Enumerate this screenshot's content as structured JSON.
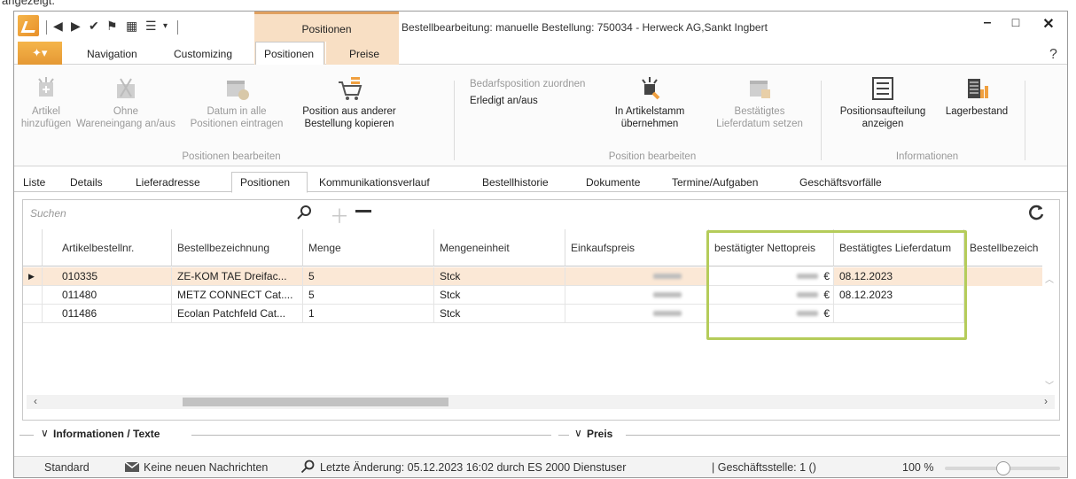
{
  "top_fragment": "angezeigt.",
  "title_bar": {
    "context_tab": "Positionen",
    "window_title": "Bestellbearbeitung: manuelle Bestellung: 750034 - Herweck AG,Sankt Ingbert",
    "minimize": "–",
    "maximize": "□",
    "close": "✕",
    "help": "?"
  },
  "menu": {
    "navigation": "Navigation",
    "customizing": "Customizing",
    "positionen": "Positionen",
    "preise": "Preise"
  },
  "ribbon": {
    "artikel_hinzufuegen": [
      "Artikel",
      "hinzufügen"
    ],
    "ohne_wareneingang": [
      "Ohne",
      "Wareneingang an/aus"
    ],
    "datum_in_alle": [
      "Datum in alle",
      "Positionen eintragen"
    ],
    "position_kopieren": [
      "Position aus anderer",
      "Bestellung kopieren"
    ],
    "group1_label": "Positionen bearbeiten",
    "bedarfsposition": "Bedarfsposition zuordnen",
    "erledigt": "Erledigt an/aus",
    "in_artikelstamm": [
      "In Artikelstamm",
      "übernehmen"
    ],
    "bestaetigtes_lieferdatum": [
      "Bestätigtes",
      "Lieferdatum setzen"
    ],
    "group2_label": "Position bearbeiten",
    "positionsaufteilung": [
      "Positionsaufteilung",
      "anzeigen"
    ],
    "lagerbestand": "Lagerbestand",
    "group3_label": "Informationen"
  },
  "tabs": [
    "Liste",
    "Details",
    "Lieferadresse",
    "Positionen",
    "Kommunikationsverlauf",
    "Bestellhistorie",
    "Dokumente",
    "Termine/Aufgaben",
    "Geschäftsvorfälle"
  ],
  "active_tab": "Positionen",
  "search": {
    "placeholder": "Suchen"
  },
  "table": {
    "headers": [
      "Artikelbestellnr.",
      "Bestellbezeichnung",
      "Menge",
      "Mengeneinheit",
      "Einkaufspreis",
      "bestätigter Nettopreis",
      "Bestätigtes Lieferdatum",
      "Bestellbezeich"
    ],
    "rows": [
      {
        "nr": "010335",
        "bez": "ZE-KOM TAE Dreifac...",
        "menge": "5",
        "einheit": "Stck",
        "currency": "€",
        "lieferdatum": "08.12.2023"
      },
      {
        "nr": "011480",
        "bez": "METZ CONNECT Cat....",
        "menge": "5",
        "einheit": "Stck",
        "currency": "€",
        "lieferdatum": "08.12.2023"
      },
      {
        "nr": "011486",
        "bez": "Ecolan Patchfeld Cat...",
        "menge": "1",
        "einheit": "Stck",
        "currency": "€",
        "lieferdatum": ""
      }
    ]
  },
  "sections": {
    "informationen": "Informationen / Texte",
    "preis": "Preis"
  },
  "status": {
    "standard": "Standard",
    "nachrichten": "Keine neuen Nachrichten",
    "letzte_aenderung": "Letzte Änderung: 05.12.2023 16:02 durch ES 2000 Dienstuser",
    "geschaeftsstelle": "| Geschäftsstelle: 1 ()",
    "zoom": "100 %"
  },
  "colors": {
    "accent_orange": "#f5b54a",
    "highlight_green": "#b5cc5a",
    "selected_row": "#fbe8d6"
  }
}
